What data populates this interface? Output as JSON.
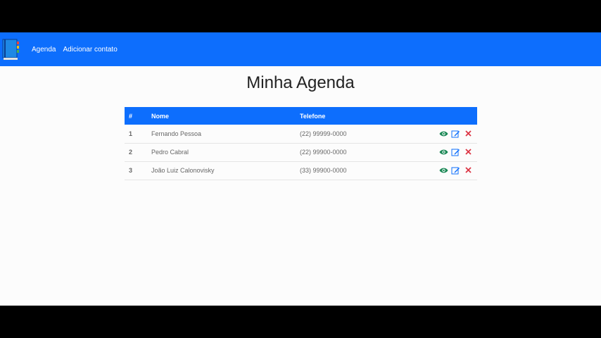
{
  "navbar": {
    "links": [
      "Agenda",
      "Adicionar contato"
    ]
  },
  "page": {
    "title": "Minha Agenda"
  },
  "table": {
    "headers": [
      "#",
      "Nome",
      "Telefone"
    ],
    "rows": [
      {
        "id": "1",
        "nome": "Fernando Pessoa",
        "telefone": "(22) 99999-0000"
      },
      {
        "id": "2",
        "nome": "Pedro Cabral",
        "telefone": "(22) 99900-0000"
      },
      {
        "id": "3",
        "nome": "João Luiz Calonovisky",
        "telefone": "(33) 99900-0000"
      }
    ]
  },
  "colors": {
    "primary": "#0d6efd",
    "view_icon": "#198754",
    "edit_icon": "#0d6efd",
    "delete_icon": "#dc3545"
  },
  "icons": {
    "brand": "address-book-icon",
    "view": "eye-icon",
    "edit": "edit-icon",
    "delete": "close-icon"
  }
}
